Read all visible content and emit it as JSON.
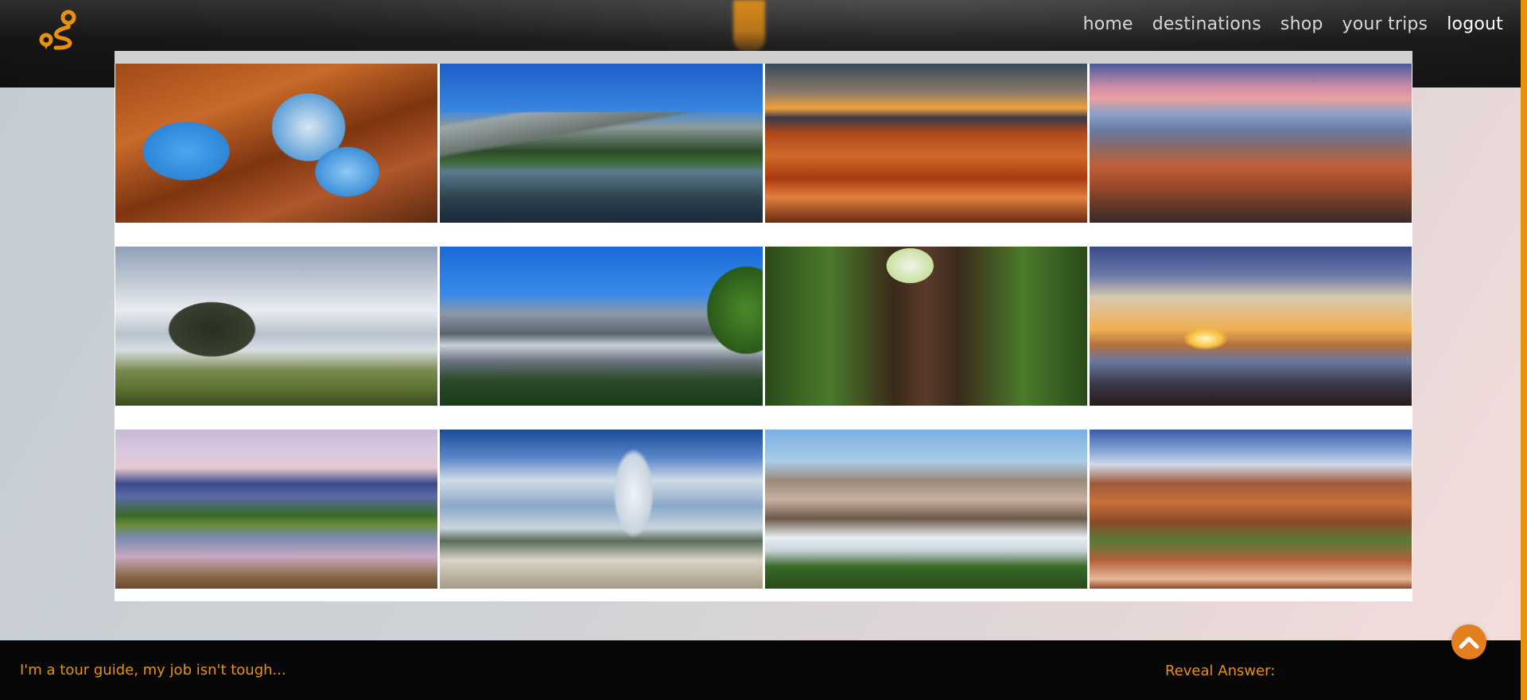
{
  "header": {
    "logo_icon": "route-pin-icon",
    "accent": "#e8910f",
    "nav": [
      {
        "label": "home"
      },
      {
        "label": "destinations"
      },
      {
        "label": "shop"
      },
      {
        "label": "your trips"
      },
      {
        "label": "logout"
      }
    ]
  },
  "gallery": {
    "images": [
      {
        "subject": "red rock arch with blue sky"
      },
      {
        "subject": "mountain peak reflected in lake"
      },
      {
        "subject": "orange hoodoo canyon at sunset"
      },
      {
        "subject": "canyon plateau under pink sky"
      },
      {
        "subject": "sea stacks on rocky coast"
      },
      {
        "subject": "rocky mountains with pine branches"
      },
      {
        "subject": "giant redwood trees looking up"
      },
      {
        "subject": "sunset over valley and clouds"
      },
      {
        "subject": "snowy peaks reflected in river"
      },
      {
        "subject": "erupting geyser under cloudy sky"
      },
      {
        "subject": "valley with granite cliffs and fog"
      },
      {
        "subject": "red canyon cliffs with green trees"
      }
    ]
  },
  "footer": {
    "joke": "I'm a tour guide, my job isn't tough...",
    "reveal_label": "Reveal Answer:"
  },
  "scroll_top_icon": "chevron-up-icon"
}
